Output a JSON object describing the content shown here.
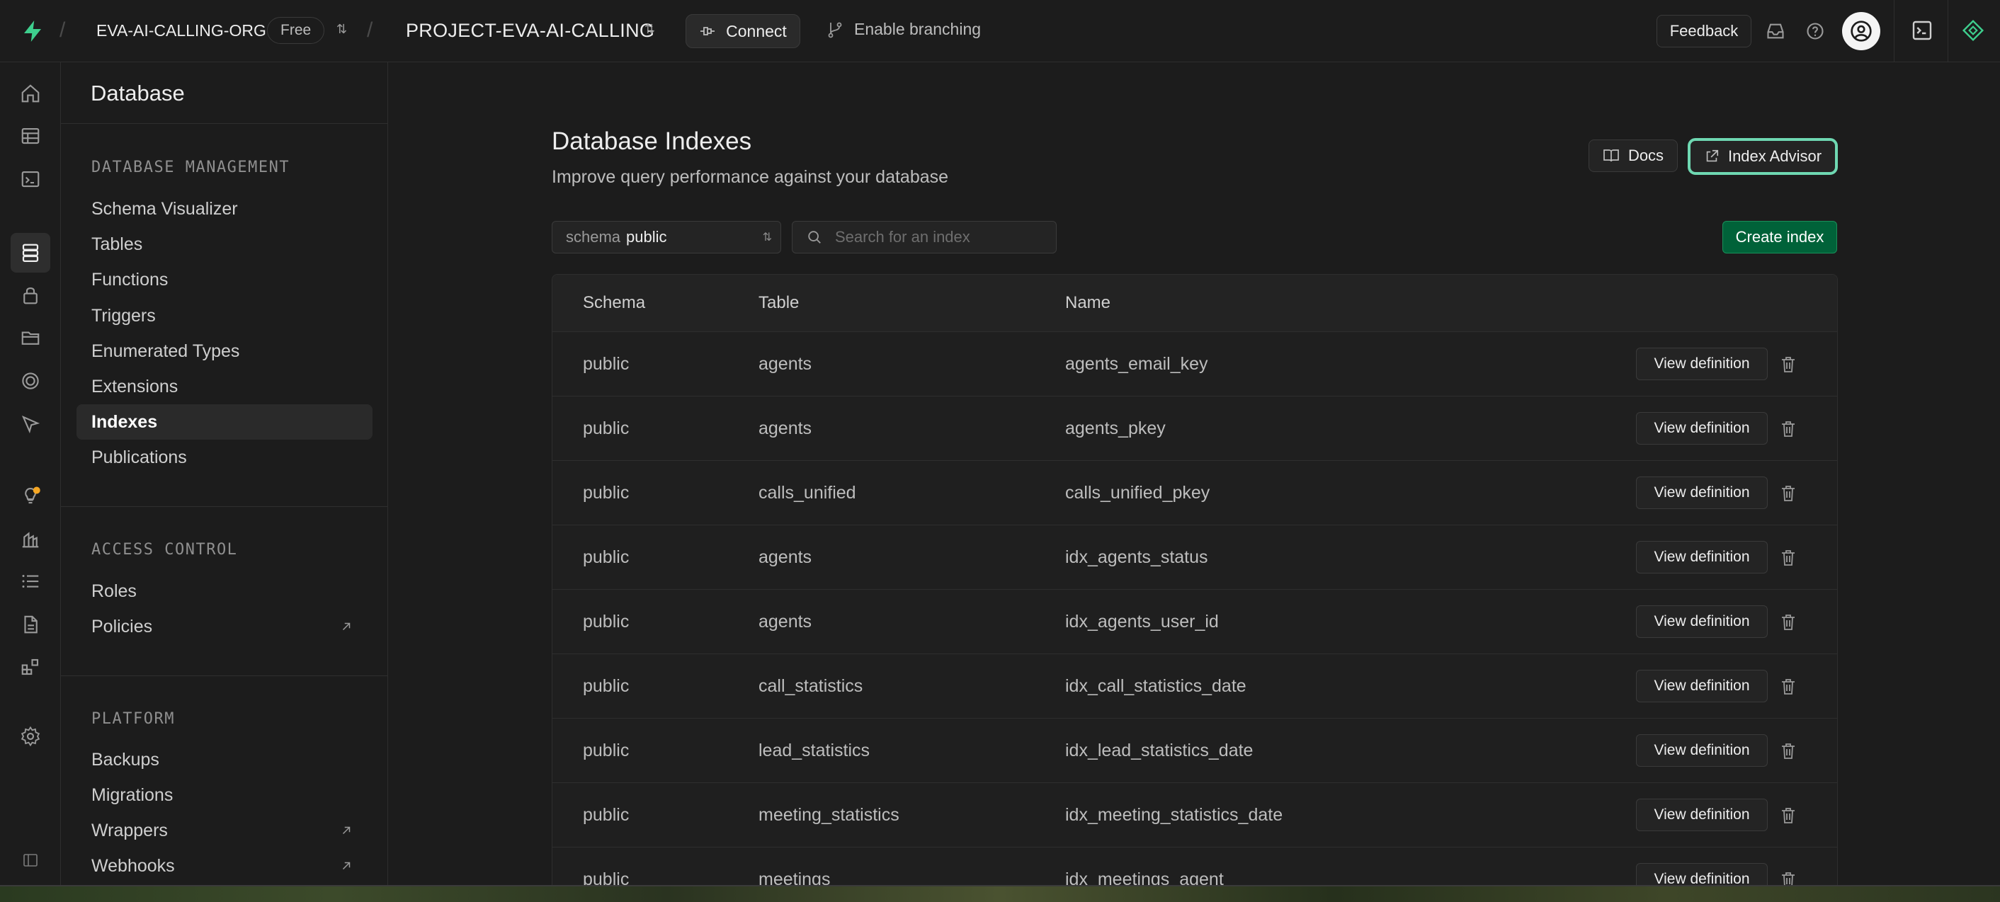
{
  "topbar": {
    "org_name": "EVA-AI-CALLING-ORG",
    "plan_badge": "Free",
    "project_name": "PROJECT-EVA-AI-CALLING",
    "connect_label": "Connect",
    "branching_label": "Enable branching",
    "feedback_label": "Feedback"
  },
  "sidebar": {
    "title": "Database",
    "sections": [
      {
        "heading": "DATABASE MANAGEMENT",
        "items": [
          "Schema Visualizer",
          "Tables",
          "Functions",
          "Triggers",
          "Enumerated Types",
          "Extensions",
          "Indexes",
          "Publications"
        ]
      },
      {
        "heading": "ACCESS CONTROL",
        "items": [
          "Roles",
          "Policies"
        ]
      },
      {
        "heading": "PLATFORM",
        "items": [
          "Backups",
          "Migrations",
          "Wrappers",
          "Webhooks"
        ]
      }
    ],
    "active_item": "Indexes"
  },
  "main": {
    "title": "Database Indexes",
    "subtitle": "Improve query performance against your database",
    "docs_label": "Docs",
    "advisor_label": "Index Advisor",
    "schema_label": "schema",
    "schema_value": "public",
    "search_placeholder": "Search for an index",
    "create_label": "Create index",
    "columns": [
      "Schema",
      "Table",
      "Name"
    ],
    "view_label": "View definition",
    "rows": [
      {
        "schema": "public",
        "table": "agents",
        "name": "agents_email_key"
      },
      {
        "schema": "public",
        "table": "agents",
        "name": "agents_pkey"
      },
      {
        "schema": "public",
        "table": "calls_unified",
        "name": "calls_unified_pkey"
      },
      {
        "schema": "public",
        "table": "agents",
        "name": "idx_agents_status"
      },
      {
        "schema": "public",
        "table": "agents",
        "name": "idx_agents_user_id"
      },
      {
        "schema": "public",
        "table": "call_statistics",
        "name": "idx_call_statistics_date"
      },
      {
        "schema": "public",
        "table": "lead_statistics",
        "name": "idx_lead_statistics_date"
      },
      {
        "schema": "public",
        "table": "meeting_statistics",
        "name": "idx_meeting_statistics_date"
      },
      {
        "schema": "public",
        "table": "meetings",
        "name": "idx_meetings_agent"
      }
    ]
  },
  "colors": {
    "brand_green": "#3ecf8e",
    "create_button": "#006239",
    "advisor_ring": "#6fd8b2",
    "notification_dot": "#f5a623"
  }
}
